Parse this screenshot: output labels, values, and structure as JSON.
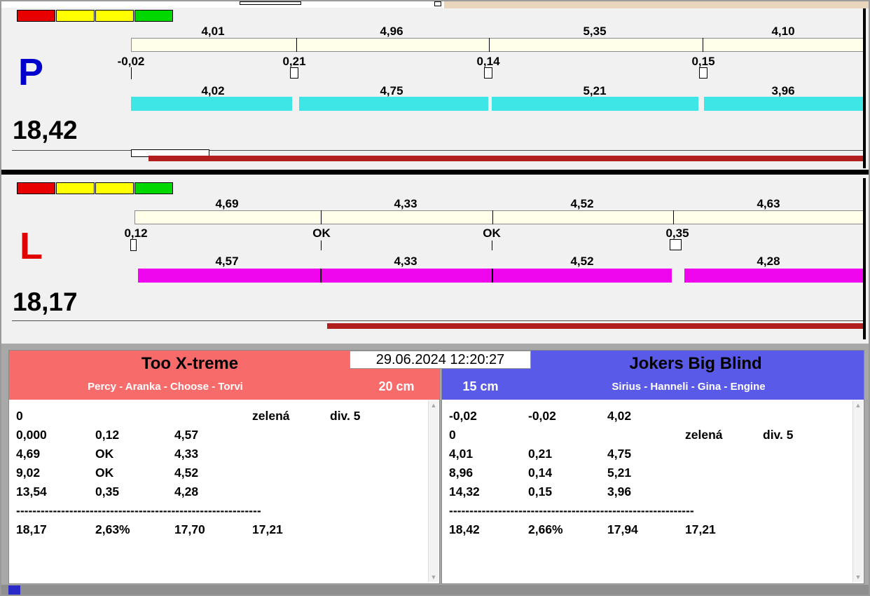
{
  "timestamp": "29.06.2024 12:20:27",
  "ui": {
    "scroll_up": "▲",
    "scroll_down": "▼"
  },
  "lanes": [
    {
      "label": "P",
      "label_color": "#0000CD",
      "total": "18,42",
      "status_colors": [
        "#E80000",
        "#FFFF00",
        "#FFFF00",
        "#00D800"
      ],
      "top_values": [
        "4,01",
        "4,96",
        "5,35",
        "4,10"
      ],
      "mid_values": [
        "-0,02",
        "0,21",
        "0,14",
        "0,15"
      ],
      "bottom_values": [
        "4,02",
        "4,75",
        "5,21",
        "3,96"
      ],
      "bar_color": "#3FE6E6",
      "progress_color": "#B01E1E"
    },
    {
      "label": "L",
      "label_color": "#E00000",
      "total": "18,17",
      "status_colors": [
        "#E80000",
        "#FFFF00",
        "#FFFF00",
        "#00D800"
      ],
      "top_values": [
        "4,69",
        "4,33",
        "4,52",
        "4,63"
      ],
      "mid_values": [
        "0,12",
        "OK",
        "OK",
        "0,35"
      ],
      "bottom_values": [
        "4,57",
        "4,33",
        "4,52",
        "4,28"
      ],
      "bar_color": "#EF06EF",
      "progress_color": "#B01E1E"
    }
  ],
  "left_panel": {
    "title": "Too X-treme",
    "subtitle": "Percy - Aranka - Choose - Torvi",
    "size_label": "20 cm",
    "header_color": "#F86B6B",
    "rows": [
      [
        "0",
        "",
        "",
        "zelená",
        "div. 5"
      ],
      [
        "0,000",
        "0,12",
        "4,57",
        "",
        ""
      ],
      [
        "4,69",
        "OK",
        "4,33",
        "",
        ""
      ],
      [
        "9,02",
        "OK",
        "4,52",
        "",
        ""
      ],
      [
        "13,54",
        "0,35",
        "4,28",
        "",
        ""
      ],
      [
        "------------------------------------------------------------",
        "",
        "",
        "",
        ""
      ],
      [
        "18,17",
        "2,63%",
        "17,70",
        "17,21",
        ""
      ]
    ]
  },
  "right_panel": {
    "title": "Jokers Big Blind",
    "subtitle": "Sirius - Hanneli - Gina - Engine",
    "size_label": "15 cm",
    "header_color": "#5A5AE8",
    "rows": [
      [
        "-0,02",
        "-0,02",
        "4,02",
        "",
        ""
      ],
      [
        "0",
        "",
        "",
        "zelená",
        "div. 5"
      ],
      [
        "4,01",
        "0,21",
        "4,75",
        "",
        ""
      ],
      [
        "8,96",
        "0,14",
        "5,21",
        "",
        ""
      ],
      [
        "14,32",
        "0,15",
        "3,96",
        "",
        ""
      ],
      [
        "------------------------------------------------------------",
        "",
        "",
        "",
        ""
      ],
      [
        "18,42",
        "2,66%",
        "17,94",
        "17,21",
        ""
      ]
    ]
  }
}
